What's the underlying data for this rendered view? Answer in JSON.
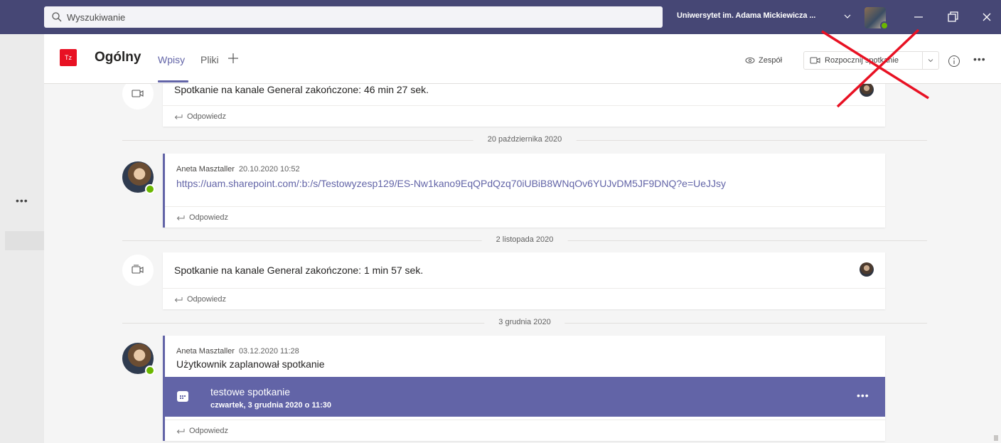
{
  "search": {
    "placeholder": "Wyszukiwanie"
  },
  "titlebar": {
    "organization": "Uniwersytet im. Adama Mickiewicza ..."
  },
  "channel": {
    "team_initials": "Tz",
    "name": "Ogólny",
    "tabs": [
      "Wpisy",
      "Pliki"
    ],
    "active_tab": "Wpisy",
    "team_button": "Zespół",
    "meet_button": "Rozpocznij spotkanie"
  },
  "feed": {
    "items": [
      {
        "type": "meeting_ended",
        "text": "Spotkanie na kanale General zakończone: 46 min 27 sek.",
        "reply": "Odpowiedz"
      },
      {
        "type": "date",
        "label": "20 października 2020"
      },
      {
        "type": "message",
        "author": "Aneta Masztaller",
        "time": "20.10.2020 10:52",
        "link": "https://uam.sharepoint.com/:b:/s/Testowyzesp129/ES-Nw1kano9EqQPdQzq70iUBiB8WNqOv6YUJvDM5JF9DNQ?e=UeJJsy",
        "reply": "Odpowiedz"
      },
      {
        "type": "date",
        "label": "2 listopada 2020"
      },
      {
        "type": "meeting_ended",
        "text": "Spotkanie na kanale General zakończone: 1 min 57 sek.",
        "reply": "Odpowiedz"
      },
      {
        "type": "date",
        "label": "3 grudnia 2020"
      },
      {
        "type": "message",
        "author": "Aneta Masztaller",
        "time": "03.12.2020 11:28",
        "text": "Użytkownik zaplanował spotkanie",
        "event": {
          "title": "testowe spotkanie",
          "when": "czwartek, 3 grudnia 2020 o 11:30",
          "icon": "calendar-icon"
        },
        "reply": "Odpowiedz"
      }
    ]
  },
  "colors": {
    "titlebar": "#464775",
    "accent": "#6264a7",
    "presence": "#6bb700",
    "annotation": "#e81123"
  }
}
